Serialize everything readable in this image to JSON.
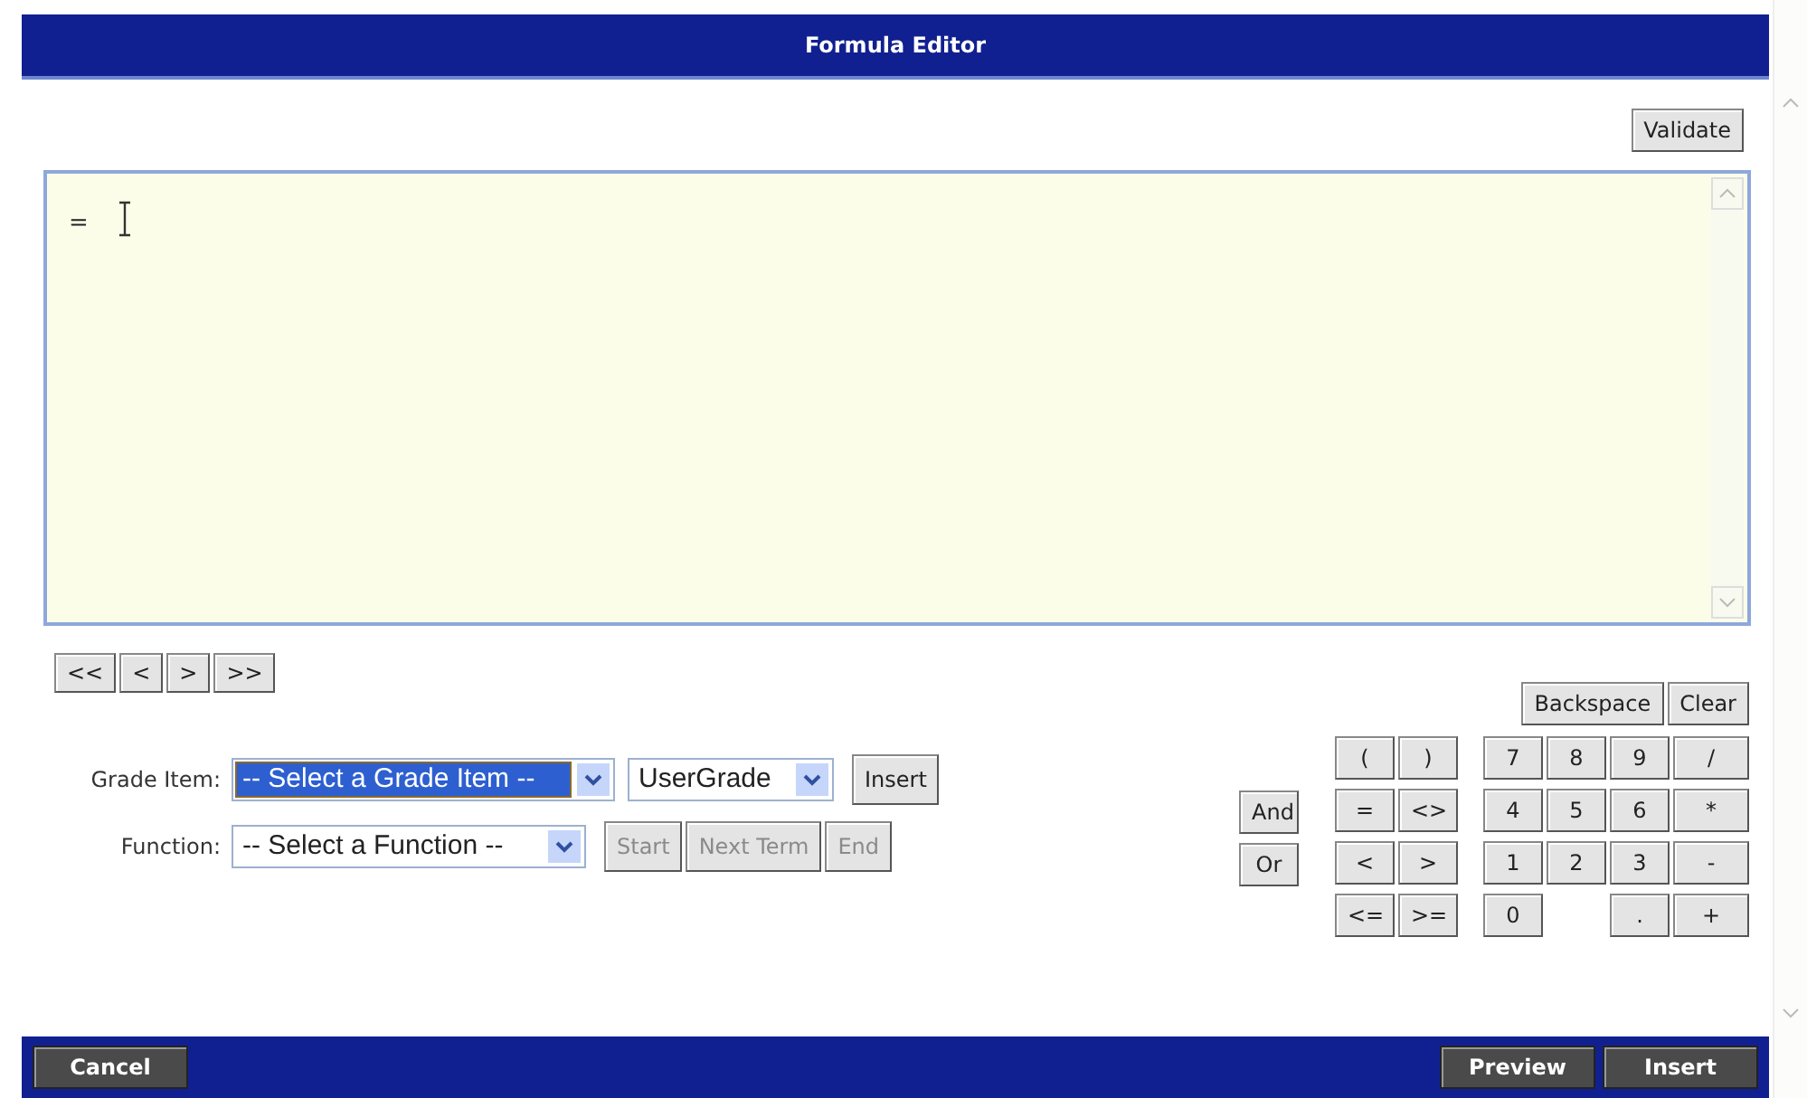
{
  "window": {
    "title": "Formula Editor"
  },
  "validate_button": {
    "label": "Validate"
  },
  "formula": {
    "value": "="
  },
  "nav_buttons": [
    "<<",
    "<",
    ">",
    ">>"
  ],
  "grade_item": {
    "label": "Grade Item:",
    "select": {
      "value": "-- Select a Grade Item --",
      "focused": true
    },
    "type_select": {
      "value": "UserGrade",
      "focused": false
    },
    "button": {
      "label": "Insert",
      "disabled": false
    }
  },
  "function": {
    "label": "Function:",
    "select": {
      "value": "-- Select a Function --",
      "focused": false
    },
    "buttons": [
      {
        "label": "Start",
        "disabled": true
      },
      {
        "label": "Next Term",
        "disabled": true
      },
      {
        "label": "End",
        "disabled": true
      }
    ]
  },
  "logic_buttons": [
    "And",
    "Or"
  ],
  "edit_buttons": [
    "Backspace",
    "Clear"
  ],
  "operator_rows": [
    [
      "(",
      ")"
    ],
    [
      "=",
      "<>"
    ],
    [
      "<",
      ">"
    ],
    [
      "<=",
      ">="
    ]
  ],
  "number_rows": [
    [
      "7",
      "8",
      "9",
      "/"
    ],
    [
      "4",
      "5",
      "6",
      "*"
    ],
    [
      "1",
      "2",
      "3",
      "-"
    ],
    [
      "0",
      ".",
      "+"
    ]
  ],
  "footer": {
    "left": [
      "Cancel"
    ],
    "right": [
      "Preview",
      "Insert"
    ]
  }
}
